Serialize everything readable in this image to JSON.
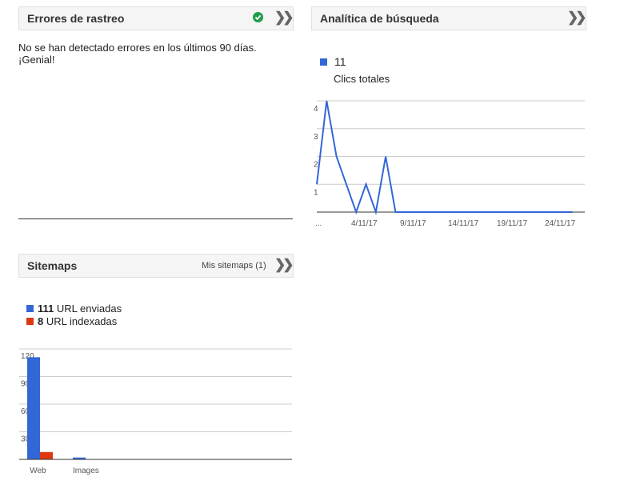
{
  "crawl_errors": {
    "title": "Errores de rastreo",
    "status_icon": "check-circle-icon",
    "status_color": "#1e9e4a",
    "line1": "No se han detectado errores en los últimos 90 días.",
    "line2": "¡Genial!",
    "expand_icon": "double-chevron-right-icon"
  },
  "search_analytics": {
    "title": "Analítica de búsqueda",
    "legend_value": "11",
    "legend_label": "Clics totales",
    "color": "#3367d6",
    "expand_icon": "double-chevron-right-icon"
  },
  "sitemaps": {
    "title": "Sitemaps",
    "link": "Mis sitemaps (1)",
    "submitted_value": "111",
    "submitted_label": "URL enviadas",
    "indexed_value": "8",
    "indexed_label": "URL indexadas",
    "submitted_color": "#3367d6",
    "indexed_color": "#dc3912",
    "expand_icon": "double-chevron-right-icon"
  },
  "chart_data": [
    {
      "type": "line",
      "x_tick_labels": [
        "...",
        "4/11/17",
        "9/11/17",
        "14/11/17",
        "19/11/17",
        "24/11/17"
      ],
      "y_ticks": [
        1,
        2,
        3,
        4
      ],
      "ylim": [
        0,
        4
      ],
      "series": [
        {
          "values": [
            1,
            4,
            2,
            1,
            0,
            1,
            0,
            2,
            0,
            0,
            0,
            0,
            0,
            0,
            0,
            0,
            0,
            0,
            0,
            0,
            0,
            0,
            0,
            0,
            0,
            0,
            0
          ]
        }
      ]
    },
    {
      "type": "bar",
      "categories": [
        "Web",
        "Images"
      ],
      "y_ticks": [
        30,
        60,
        90,
        120
      ],
      "ylim": [
        0,
        120
      ],
      "series": [
        {
          "values": [
            111,
            2
          ]
        },
        {
          "values": [
            8,
            0
          ]
        }
      ]
    }
  ]
}
